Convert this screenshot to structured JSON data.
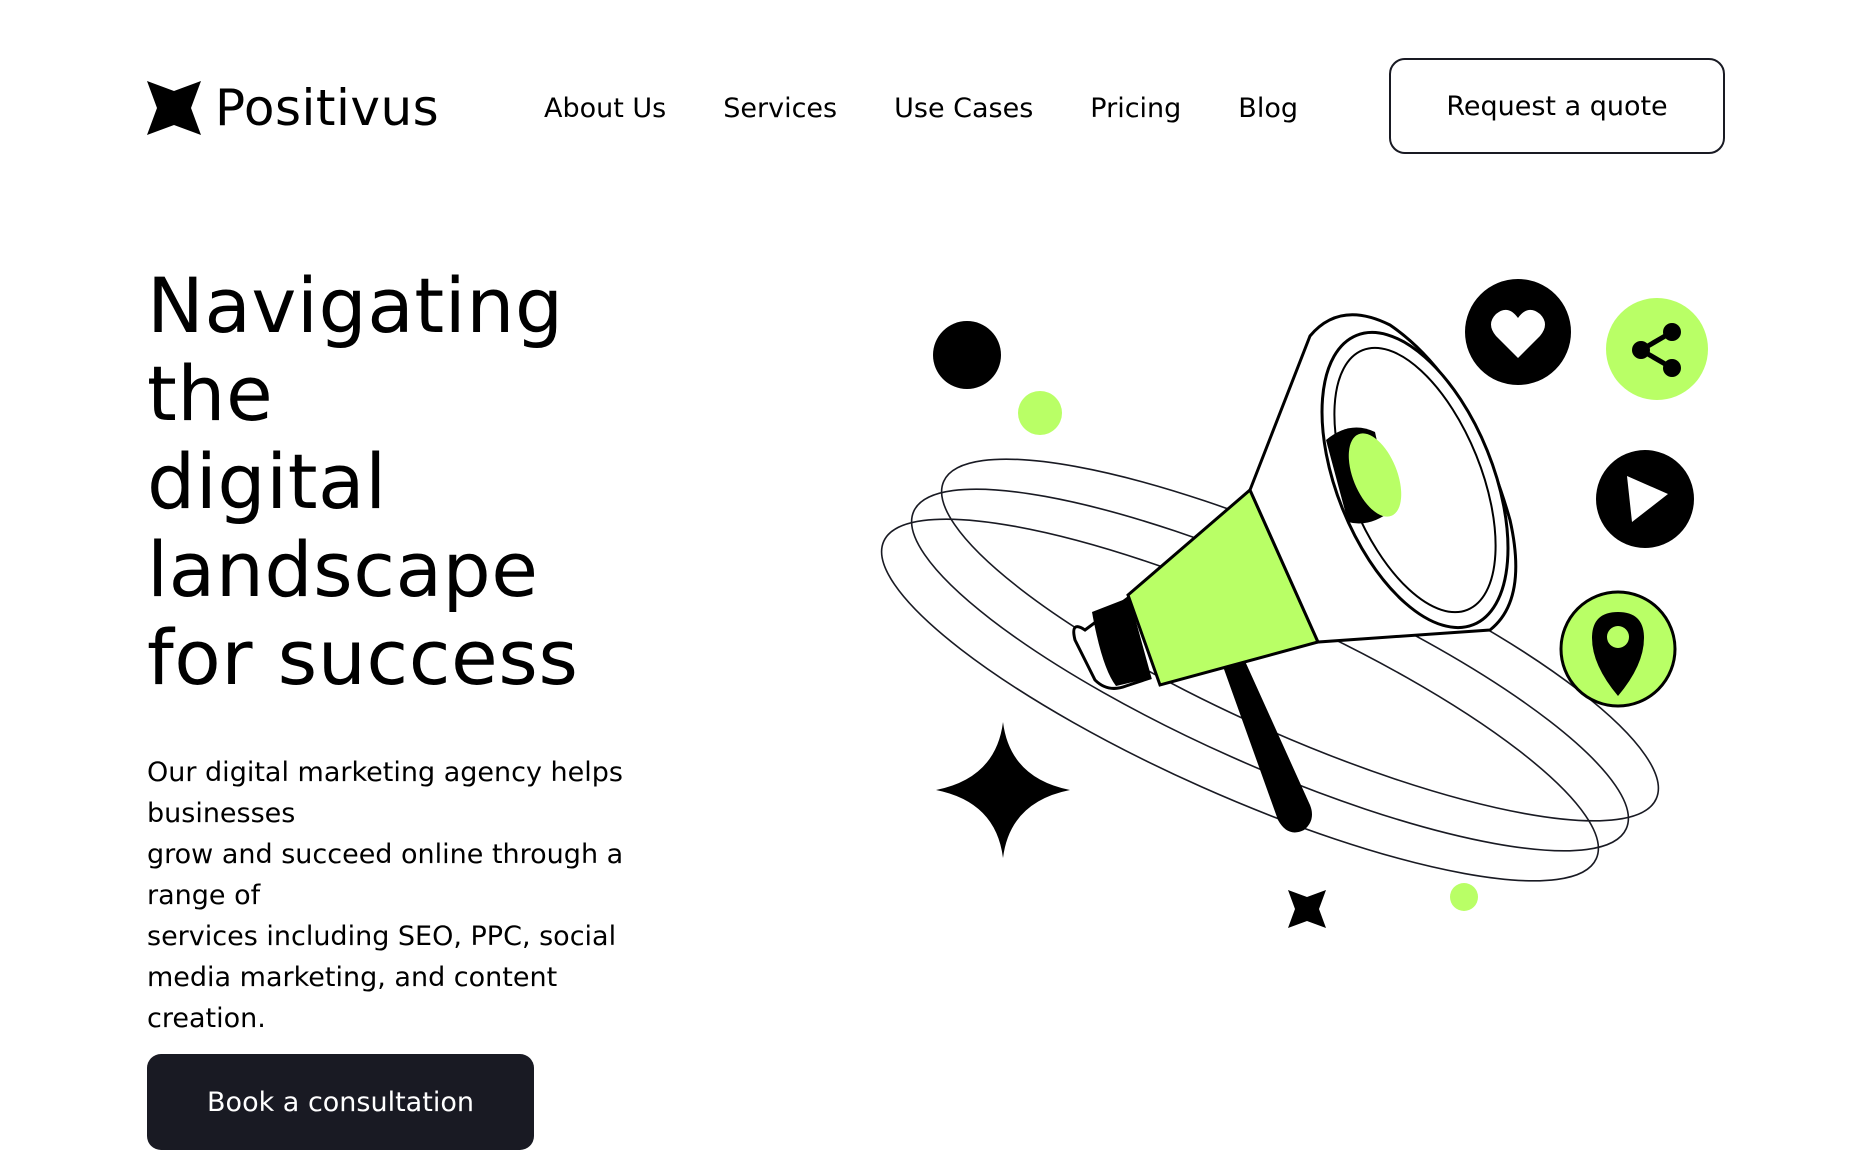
{
  "brand": {
    "name": "Positivus"
  },
  "nav": {
    "items": [
      {
        "label": "About Us"
      },
      {
        "label": "Services"
      },
      {
        "label": "Use Cases"
      },
      {
        "label": "Pricing"
      },
      {
        "label": "Blog"
      }
    ],
    "cta_label": "Request a quote"
  },
  "hero": {
    "title_lines": [
      "Navigating",
      "the",
      "digital",
      "landscape",
      "for success"
    ],
    "description_lines": [
      "Our digital marketing agency helps",
      "businesses",
      "grow and succeed online through a",
      "range of",
      "services including SEO, PPC, social",
      "media marketing, and content",
      "creation."
    ],
    "cta_label": "Book a consultation"
  },
  "illustration": {
    "icons": [
      "megaphone-icon",
      "heart-icon",
      "share-icon",
      "play-icon",
      "location-pin-icon",
      "sparkle-star-icon"
    ]
  },
  "colors": {
    "accent": "#B9FF66",
    "dark": "#191A23",
    "background": "#FFFFFF"
  }
}
